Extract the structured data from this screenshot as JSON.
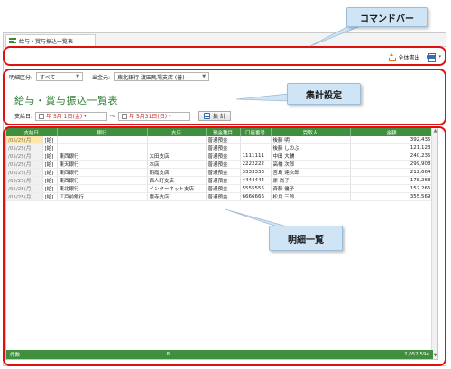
{
  "window": {
    "tab_title": "給与・賞与振込一覧表"
  },
  "command_bar": {
    "export_label": "全体書出",
    "print_icon": "printer-icon"
  },
  "filters": {
    "category_label": "明細区分:",
    "category_value": "すべて",
    "source_label": "出金元:",
    "source_value": "東北銀行 渡田馬場支店 (普)"
  },
  "report": {
    "title": "給与・賞与振込一覧表",
    "date_label": "支給日:",
    "date_from": "年 5月 1日(金)",
    "date_sep": "～",
    "date_to": "年 5月31日(日)",
    "sum_button": "集 計"
  },
  "table": {
    "columns": [
      "支給日",
      "銀行",
      "支店",
      "預金種目",
      "口座番号",
      "受取人",
      "金額"
    ],
    "rows": [
      [
        "/05/25(月)",
        "[給]",
        "",
        "",
        "普通預金",
        "",
        "後藤 明",
        "392,435"
      ],
      [
        "/05/25(月)",
        "[給]",
        "",
        "",
        "普通預金",
        "",
        "後藤 しのぶ",
        "121,123"
      ],
      [
        "/05/25(月)",
        "[給]",
        "東西銀行",
        "大田支店",
        "普通預金",
        "1111111",
        "中田 大輔",
        "240,235"
      ],
      [
        "/05/25(月)",
        "[給]",
        "東天銀行",
        "本店",
        "普通預金",
        "2222222",
        "高橋 次郎",
        "299,908"
      ],
      [
        "/05/25(月)",
        "[給]",
        "東西銀行",
        "朝霞支店",
        "普通預金",
        "3333333",
        "宮島 達次郎",
        "212,664"
      ],
      [
        "/05/25(月)",
        "[給]",
        "東西銀行",
        "西人町支店",
        "普通預金",
        "4444444",
        "原 尚子",
        "178,268"
      ],
      [
        "/05/25(月)",
        "[給]",
        "東北銀行",
        "インターネット支店",
        "普通預金",
        "5555555",
        "斉藤 優子",
        "152,265"
      ],
      [
        "/05/25(月)",
        "[給]",
        "江戸前銀行",
        "農寺支店",
        "普通預金",
        "6666666",
        "松月 三郎",
        "355,569"
      ]
    ],
    "footer": {
      "label": "件数",
      "count": "8",
      "total": "2,052,594"
    }
  },
  "annotations": {
    "command_bar": "コマンドバー",
    "aggregate_settings": "集計設定",
    "detail_list": "明細一覧"
  },
  "colors": {
    "accent_green": "#3f8f3f",
    "callout_red": "#e01010",
    "balloon_blue": "#cfe4f5"
  }
}
